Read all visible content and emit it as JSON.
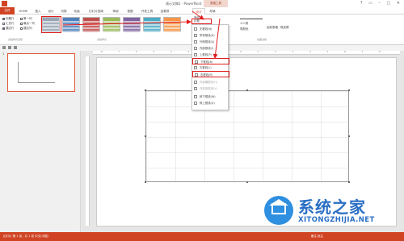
{
  "titlebar": {
    "title": "演示文稿1 - PowerPoint",
    "context_group": "表格工具",
    "window_controls": "? ▭ – ▢ ✕"
  },
  "tabs": [
    {
      "label": "文件"
    },
    {
      "label": "HOME"
    },
    {
      "label": "插入"
    },
    {
      "label": "设计"
    },
    {
      "label": "切换"
    },
    {
      "label": "动画"
    },
    {
      "label": "幻灯片放映"
    },
    {
      "label": "审阅"
    },
    {
      "label": "视图"
    },
    {
      "label": "开发工具"
    },
    {
      "label": "加载项"
    },
    {
      "label": "设计"
    },
    {
      "label": "布局"
    }
  ],
  "ribbon": {
    "options": [
      {
        "label": "标题行",
        "checked": true
      },
      {
        "label": "汇总行",
        "checked": false
      },
      {
        "label": "镶边行",
        "checked": true
      },
      {
        "label": "第一列",
        "checked": false
      },
      {
        "label": "最后一列",
        "checked": false
      },
      {
        "label": "镶边列",
        "checked": false
      }
    ],
    "group_options_label": "表格样式选项",
    "group_styles_label": "表格样式",
    "group_borders_label": "绘图边框",
    "swatch_colors": [
      "#9aa5b4",
      "#4f81bd",
      "#c0504d",
      "#9bbb59",
      "#8064a2",
      "#4bacc6",
      "#f79646"
    ],
    "shading_label": "底纹",
    "borders_label": "边框",
    "pen_weight": "1.0 磅",
    "pen_color_label": "笔颜色",
    "draw_table_label": "绘制表格",
    "eraser_label": "橡皮擦"
  },
  "thumbnail": {
    "number": "1"
  },
  "ruler": [
    "8",
    "7",
    "6",
    "5",
    "4",
    "3",
    "2",
    "1",
    "0",
    "1",
    "2",
    "3",
    "4",
    "5",
    "6",
    "7",
    "8"
  ],
  "dropdown": {
    "button_label": "边框",
    "items": [
      {
        "label": "无框线(N)",
        "enabled": true
      },
      {
        "label": "所有框线(A)",
        "enabled": true
      },
      {
        "label": "外侧框线(S)",
        "enabled": true
      },
      {
        "label": "内部框线(I)",
        "enabled": true
      },
      {
        "label": "上框线(P)",
        "enabled": true
      },
      {
        "label": "下框线(B)",
        "enabled": true
      },
      {
        "label": "左框线(L)",
        "enabled": true
      },
      {
        "label": "右框线(R)",
        "enabled": true
      },
      {
        "label": "内部横框线(H)",
        "enabled": false
      },
      {
        "label": "内部竖框线(V)",
        "enabled": false
      },
      {
        "label": "斜下框线(W)",
        "enabled": true
      },
      {
        "label": "斜上框线(U)",
        "enabled": true
      }
    ]
  },
  "status": {
    "left": "幻灯片 第 1 张，共 1 张   中文(中国)",
    "right": "备注   批注"
  },
  "watermark": {
    "cn": "系统之家",
    "en": "XITONGZHIJIA.NET"
  },
  "colors": {
    "accent": "#d04423",
    "highlight": "#e01e1e",
    "brand": "#2a6fc5"
  }
}
